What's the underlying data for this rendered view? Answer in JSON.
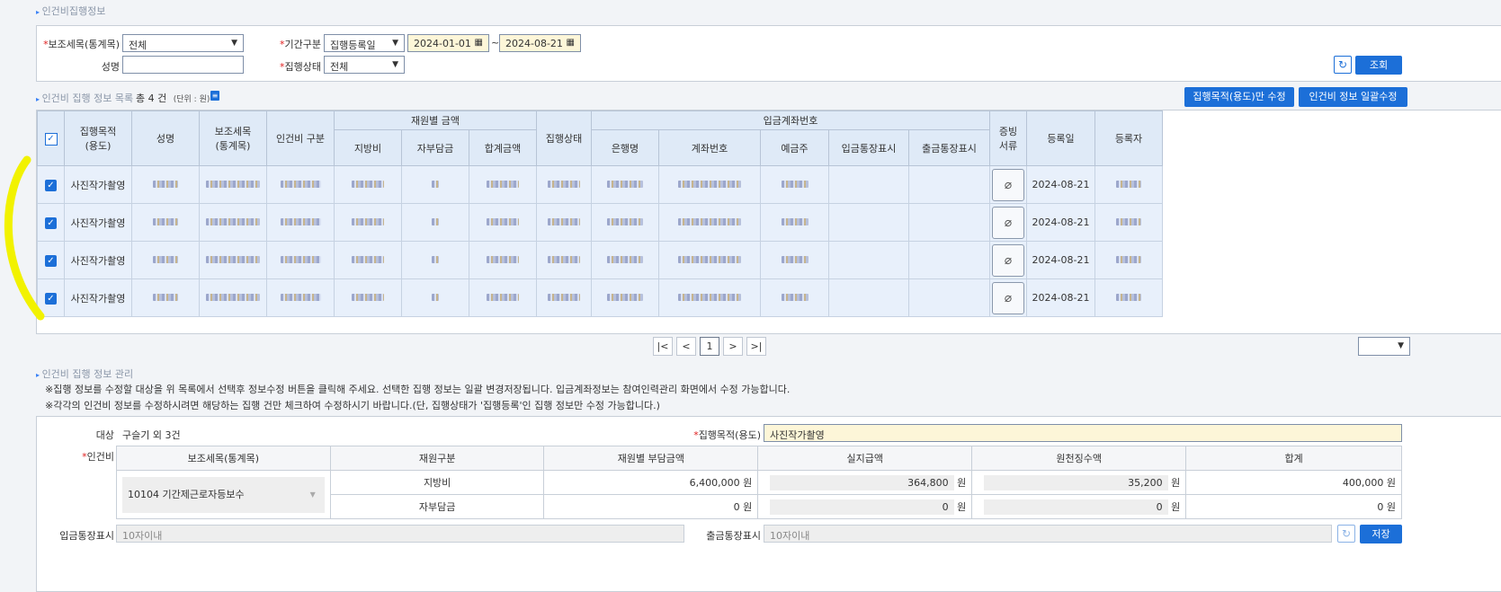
{
  "section1_title": "인건비집행정보",
  "search": {
    "sub_item_label": "보조세목(통계목)",
    "sub_item_value": "전체",
    "name_label": "성명",
    "name_value": "",
    "period_label": "기간구분",
    "period_value": "집행등록일",
    "date_from": "2024-01-01",
    "date_sep": "~",
    "date_to": "2024-08-21",
    "status_label": "집행상태",
    "status_value": "전체",
    "search_btn": "조회"
  },
  "list": {
    "title": "인건비 집행 정보 목록",
    "count_prefix": "총",
    "count": "4",
    "count_suffix": "건",
    "unit": "(단위 : 원)",
    "btn_edit_purpose": "집행목적(용도)만 수정",
    "btn_bulk_edit": "인건비 정보 일괄수정",
    "headers": {
      "purpose": "집행목적\n(용도)",
      "name": "성명",
      "sub_item": "보조세목\n(통계목)",
      "labor_type": "인건비 구분",
      "fund_amount": "재원별 금액",
      "local": "지방비",
      "self": "자부담금",
      "total": "합계금액",
      "status": "집행상태",
      "account": "입금계좌번호",
      "bank": "은행명",
      "account_no": "계좌번호",
      "holder": "예금주",
      "deposit_memo": "입금통장표시",
      "withdraw_memo": "출금통장표시",
      "evidence": "증빙\n서류",
      "reg_date": "등록일",
      "registrant": "등록자"
    },
    "rows": [
      {
        "purpose": "사진작가촬영",
        "reg_date": "2024-08-21"
      },
      {
        "purpose": "사진작가촬영",
        "reg_date": "2024-08-21"
      },
      {
        "purpose": "사진작가촬영",
        "reg_date": "2024-08-21"
      },
      {
        "purpose": "사진작가촬영",
        "reg_date": "2024-08-21"
      }
    ],
    "page": "1"
  },
  "manage": {
    "title": "인건비 집행 정보 관리",
    "note1": "※집행 정보를 수정할 대상을 위 목록에서 선택후 정보수정 버튼을 클릭해 주세요.  선택한 집행 정보는 일괄 변경저장됩니다.  입금계좌정보는 참여인력관리 화면에서 수정 가능합니다.",
    "note2": "※각각의 인건비 정보를 수정하시려면 해당하는 집행 건만 체크하여 수정하시기 바랍니다.(단, 집행상태가 '집행등록'인 집행 정보만 수정 가능합니다.)",
    "target_label": "대상",
    "target_value": "구슬기 외 3건",
    "purpose_label": "집행목적(용도)",
    "purpose_value": "사진작가촬영",
    "labor_label": "인건비",
    "th_sub_item": "보조세목(통계목)",
    "th_fund_type": "재원구분",
    "th_fund_amount": "재원별 부담금액",
    "th_actual": "실지급액",
    "th_withholding": "원천징수액",
    "th_sum": "합계",
    "sub_item_value": "10104 기간제근로자등보수",
    "won": "원",
    "rows": [
      {
        "type": "지방비",
        "amount": "6,400,000",
        "actual": "364,800",
        "withholding": "35,200",
        "sum": "400,000"
      },
      {
        "type": "자부담금",
        "amount": "0",
        "actual": "0",
        "withholding": "0",
        "sum": "0"
      }
    ],
    "deposit_label": "입금통장표시",
    "deposit_placeholder": "10자이내",
    "withdraw_label": "출금통장표시",
    "withdraw_placeholder": "10자이내",
    "save_btn": "저장"
  }
}
